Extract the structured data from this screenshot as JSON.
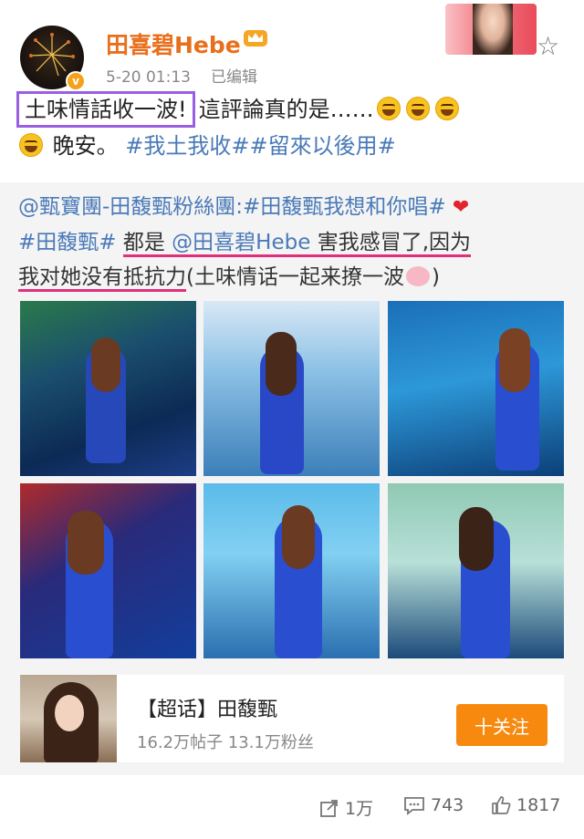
{
  "header": {
    "username": "田喜碧Hebe",
    "time": "5-20 01:13",
    "edited": "已编辑",
    "badge": "v"
  },
  "post": {
    "highlight": "土味情話收一波!",
    "text1": "這評論真的是……",
    "text2": "晚安。",
    "tags": "#我土我收##留來以後用#"
  },
  "repost": {
    "line1_tag": "@甄寶團-田馥甄粉絲團:#田馥甄我想和你唱#",
    "line2_tag": "#田馥甄#",
    "line2_a": "都是",
    "line2_mention": "@田喜碧Hebe",
    "line2_b": "害我感冒了,",
    "line2_c": "因为",
    "line3_a": "我对她没有抵抗力",
    "line3_b": "(土味情话一起来撩一波",
    "line3_end": ")"
  },
  "card": {
    "title": "【超话】田馥甄",
    "sub": "16.2万帖子 13.1万粉丝",
    "follow": "十关注"
  },
  "footer": {
    "repost_count": "1万",
    "comment_count": "743",
    "like_count": "1817"
  },
  "colors": {
    "username": "#e86f1b",
    "link": "#4a7ab8",
    "highlight_border": "#9a5ee2",
    "underline": "#e0307b",
    "follow": "#f7890f"
  }
}
